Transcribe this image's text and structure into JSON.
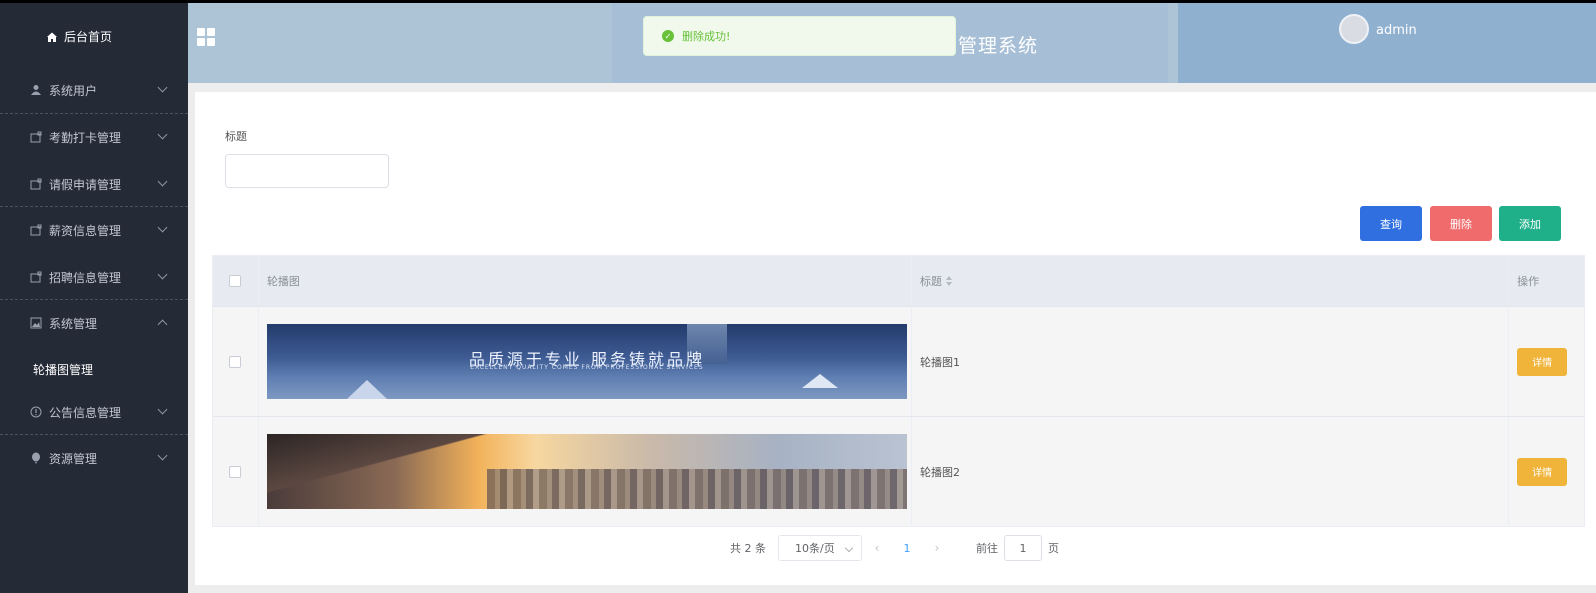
{
  "sidebar": {
    "home": "后台首页",
    "items": [
      {
        "label": "系统用户",
        "icon": "user-icon",
        "expanded": false
      },
      {
        "label": "考勤打卡管理",
        "icon": "folder-icon",
        "expanded": false
      },
      {
        "label": "请假申请管理",
        "icon": "folder-icon",
        "expanded": false
      },
      {
        "label": "薪资信息管理",
        "icon": "folder-icon",
        "expanded": false
      },
      {
        "label": "招聘信息管理",
        "icon": "folder-icon",
        "expanded": false
      },
      {
        "label": "系统管理",
        "icon": "image-icon",
        "expanded": true
      },
      {
        "label": "公告信息管理",
        "icon": "info-icon",
        "expanded": false
      },
      {
        "label": "资源管理",
        "icon": "balloon-icon",
        "expanded": false
      }
    ],
    "sub_item": "轮播图管理"
  },
  "header": {
    "system_title": "管理系统",
    "username": "admin"
  },
  "toast": {
    "message": "删除成功!",
    "color": "#67c23a"
  },
  "search": {
    "title_label": "标题",
    "title_value": ""
  },
  "buttons": {
    "query": "查询",
    "delete": "删除",
    "add": "添加"
  },
  "table": {
    "columns": [
      "轮播图",
      "标题",
      "操作"
    ],
    "rows": [
      {
        "title": "轮播图1",
        "banner_text": "品质源于专业 服务铸就品牌",
        "banner_sub": "EXCELLENT QUALITY COMES FROM PROFESSIONAL SERVICES",
        "action": "详情"
      },
      {
        "title": "轮播图2",
        "action": "详情"
      }
    ]
  },
  "pagination": {
    "total": "共 2 条",
    "page_size": "10条/页",
    "current_page": "1",
    "goto_prefix": "前往",
    "goto_value": "1",
    "goto_suffix": "页"
  }
}
